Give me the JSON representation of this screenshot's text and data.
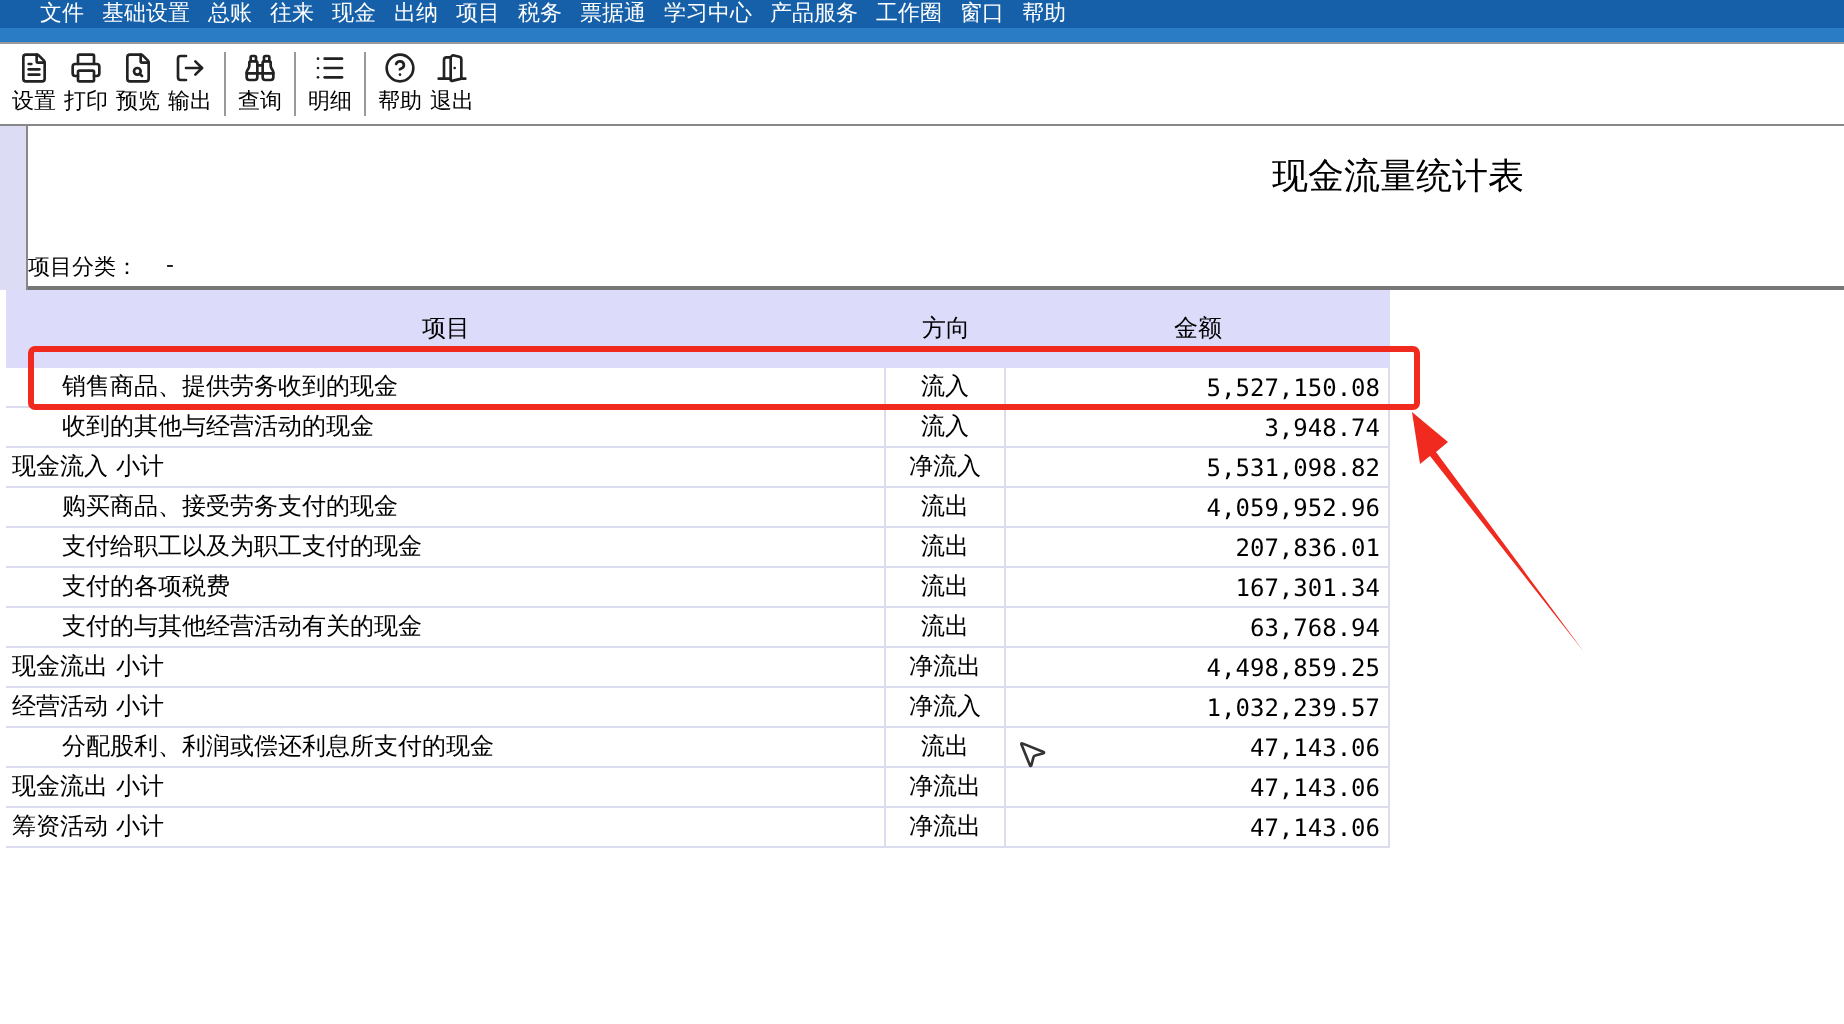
{
  "menu": [
    "文件",
    "基础设置",
    "总账",
    "往来",
    "现金",
    "出纳",
    "项目",
    "税务",
    "票据通",
    "学习中心",
    "产品服务",
    "工作圈",
    "窗口",
    "帮助"
  ],
  "toolbar": [
    {
      "kind": "setup",
      "label": "设置"
    },
    {
      "kind": "print",
      "label": "打印"
    },
    {
      "kind": "preview",
      "label": "预览"
    },
    {
      "kind": "export",
      "label": "输出"
    },
    {
      "kind": "query",
      "label": "查询"
    },
    {
      "kind": "detail",
      "label": "明细"
    },
    {
      "kind": "help",
      "label": "帮助"
    },
    {
      "kind": "exit",
      "label": "退出"
    }
  ],
  "report": {
    "title": "现金流量统计表",
    "category_label": "项目分类：",
    "category_value": "-"
  },
  "table": {
    "columns": [
      "项目",
      "方向",
      "金额"
    ],
    "rows": [
      {
        "kind": "item",
        "item": "销售商品、提供劳务收到的现金",
        "direction": "流入",
        "amount": "5,527,150.08"
      },
      {
        "kind": "item",
        "item": "收到的其他与经营活动的现金",
        "direction": "流入",
        "amount": "3,948.74"
      },
      {
        "kind": "subtotal",
        "item": "现金流入 小计",
        "direction": "净流入",
        "amount": "5,531,098.82"
      },
      {
        "kind": "item",
        "item": "购买商品、接受劳务支付的现金",
        "direction": "流出",
        "amount": "4,059,952.96"
      },
      {
        "kind": "item",
        "item": "支付给职工以及为职工支付的现金",
        "direction": "流出",
        "amount": "207,836.01"
      },
      {
        "kind": "item",
        "item": "支付的各项税费",
        "direction": "流出",
        "amount": "167,301.34"
      },
      {
        "kind": "item",
        "item": "支付的与其他经营活动有关的现金",
        "direction": "流出",
        "amount": "63,768.94"
      },
      {
        "kind": "subtotal",
        "item": "现金流出 小计",
        "direction": "净流出",
        "amount": "4,498,859.25"
      },
      {
        "kind": "subtotal",
        "item": "经营活动 小计",
        "direction": "净流入",
        "amount": "1,032,239.57"
      },
      {
        "kind": "item",
        "item": "分配股利、利润或偿还利息所支付的现金",
        "direction": "流出",
        "amount": "47,143.06"
      },
      {
        "kind": "subtotal",
        "item": "现金流出 小计",
        "direction": "净流出",
        "amount": "47,143.06"
      },
      {
        "kind": "subtotal",
        "item": "筹资活动 小计",
        "direction": "净流出",
        "amount": "47,143.06"
      }
    ]
  }
}
